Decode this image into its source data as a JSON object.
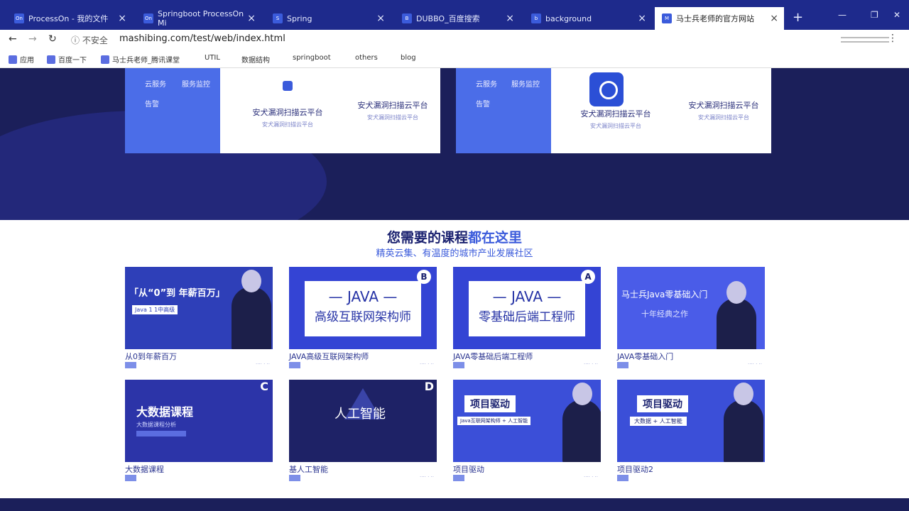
{
  "browser": {
    "tabs": [
      {
        "label": "ProcessOn - 我的文件",
        "fav": "On"
      },
      {
        "label": "Springboot ProcessOn Mi",
        "fav": "On"
      },
      {
        "label": "Spring",
        "fav": "S"
      },
      {
        "label": "DUBBO_百度搜索",
        "fav": "B"
      },
      {
        "label": "background",
        "fav": "b"
      },
      {
        "label": "马士兵老师的官方网站",
        "fav": "M"
      }
    ],
    "new_tab": "+",
    "address": {
      "security": "不安全",
      "url": "mashibing.com/test/web/index.html"
    },
    "bookmarks": [
      "应用",
      "百度一下",
      "马士兵老师_腾讯课堂",
      "UTIL",
      "数据结构",
      "springboot",
      "others",
      "blog"
    ]
  },
  "hero": {
    "panels": [
      {
        "side_items": [
          "云服务",
          "服务监控",
          "告警"
        ],
        "scanners": [
          {
            "title": "安犬漏洞扫描云平台",
            "sub": "安犬漏洞扫描云平台"
          },
          {
            "title": "安犬漏洞扫描云平台",
            "sub": "安犬漏洞扫描云平台"
          }
        ]
      },
      {
        "side_items": [
          "云服务",
          "服务监控",
          "告警"
        ],
        "scanners": [
          {
            "title": "安犬漏洞扫描云平台",
            "sub": "安犬漏洞扫描云平台"
          },
          {
            "title": "安犬漏洞扫描云平台",
            "sub": "安犬漏洞扫描云平台"
          }
        ]
      }
    ]
  },
  "courses": {
    "title_a": "您需要的课程",
    "title_b": "都在这里",
    "subtitle": "精英云集、有温度的城市产业发展社区",
    "items": [
      {
        "label": "从0到年薪百万",
        "thumb_text": "「从“0”到 年薪百万」",
        "thumb_sub": "Java 1 1中高级",
        "badge": ""
      },
      {
        "label": "JAVA高级互联网架构师",
        "thumb_text": "— JAVA —",
        "thumb_sub": "高级互联网架构师",
        "badge": "B"
      },
      {
        "label": "JAVA零基础后端工程师",
        "thumb_text": "— JAVA —",
        "thumb_sub": "零基础后端工程师",
        "badge": "A"
      },
      {
        "label": "JAVA零基础入门",
        "thumb_text": "马士兵Java零基础入门",
        "thumb_sub": "十年经典之作",
        "badge": ""
      },
      {
        "label": "大数据课程",
        "thumb_text": "大数据课程",
        "thumb_sub": "大数据课程分析",
        "badge": "C"
      },
      {
        "label": "基人工智能",
        "thumb_text": "人工智能",
        "thumb_sub": "",
        "badge": "D"
      },
      {
        "label": "项目驱动",
        "thumb_text": "项目驱动",
        "thumb_sub": "Java互联网架构师 + 人工智能",
        "badge": ""
      },
      {
        "label": "项目驱动2",
        "thumb_text": "项目驱动",
        "thumb_sub": "大数据 + 人工智能",
        "badge": ""
      }
    ]
  },
  "colors": {
    "brand": "#3b5bdb",
    "dark": "#1b1f5a",
    "title": "#1b2270"
  }
}
